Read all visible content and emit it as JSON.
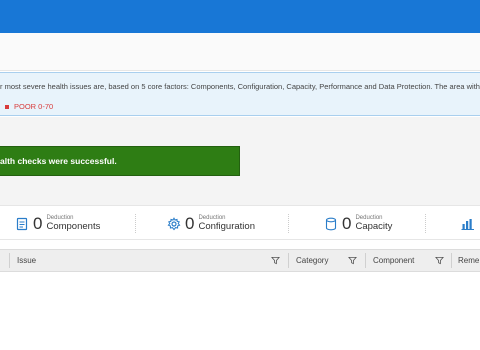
{
  "header": {
    "brand_color": "#1877d6"
  },
  "info_banner": {
    "text": "r most severe health issues are, based on 5 core factors: Components, Configuration, Capacity, Performance and Data Protection. The area with the highest",
    "legend_label": "POOR 0-70",
    "legend_color": "#d83b3b"
  },
  "success": {
    "text": "alth checks were successful.",
    "color": "#2e7d14"
  },
  "metrics": [
    {
      "icon": "document-icon",
      "count": "0",
      "small": "Deduction",
      "label": "Components"
    },
    {
      "icon": "gear-icon",
      "count": "0",
      "small": "Deduction",
      "label": "Configuration"
    },
    {
      "icon": "database-icon",
      "count": "0",
      "small": "Deduction",
      "label": "Capacity"
    },
    {
      "icon": "bar-chart-icon"
    }
  ],
  "table": {
    "columns": [
      {
        "label": "Issue"
      },
      {
        "label": "Category"
      },
      {
        "label": "Component"
      },
      {
        "label": "Reme"
      }
    ]
  }
}
